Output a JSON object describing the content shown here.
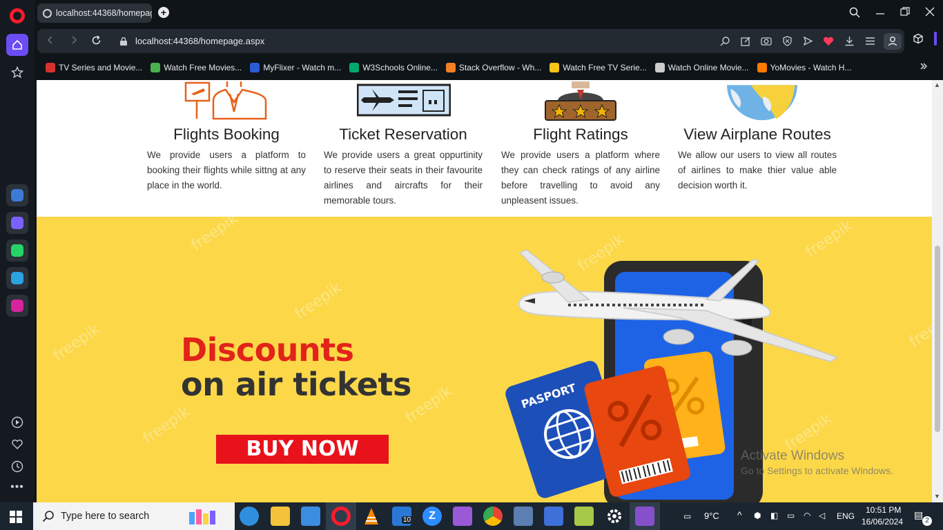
{
  "browser": {
    "tab_title": "localhost:44368/homepag",
    "url": "localhost:44368/homepage.aspx",
    "bookmarks": [
      {
        "label": "TV Series and Movie...",
        "color": "#d8312d"
      },
      {
        "label": "Watch Free Movies...",
        "color": "#4caf50"
      },
      {
        "label": "MyFlixer - Watch m...",
        "color": "#2b5cd6"
      },
      {
        "label": "W3Schools Online...",
        "color": "#04aa6d"
      },
      {
        "label": "Stack Overflow - Wh...",
        "color": "#f48024"
      },
      {
        "label": "Watch Free TV Serie...",
        "color": "#f5c518"
      },
      {
        "label": "Watch Online Movie...",
        "color": "#cccccc"
      },
      {
        "label": "YoMovies - Watch H...",
        "color": "#ff7a00"
      }
    ],
    "sidebar_apps": [
      {
        "name": "aria-icon",
        "color": "#3a7bd5"
      },
      {
        "name": "messenger-icon",
        "color": "#7b61ff"
      },
      {
        "name": "whatsapp-icon",
        "color": "#25d366"
      },
      {
        "name": "telegram-icon",
        "color": "#2aa3de"
      },
      {
        "name": "instagram-icon",
        "color": "#d6249f"
      }
    ]
  },
  "features": [
    {
      "title": "Flights Booking",
      "description": "We provide users a platform to booking their flights while sittng at any place in the world."
    },
    {
      "title": "Ticket Reservation",
      "description": "We provide users a great oppurtinity to reserve their seats in their favourite airlines and aircrafts for their memorable tours."
    },
    {
      "title": "Flight Ratings",
      "description": "We provide users a platform where they can check ratings of any airline before travelling to avoid any unpleasent issues."
    },
    {
      "title": "View Airplane Routes",
      "description": "We allow our users to view all routes of airlines to make thier value able decision worth it."
    }
  ],
  "banner": {
    "headline_line1": "Discounts",
    "headline_line2": "on air tickets",
    "cta_label": "BUY NOW",
    "passport_label": "PASPORT",
    "watermark": "freepik"
  },
  "activation": {
    "title": "Activate Windows",
    "subtitle": "Go to Settings to activate Windows."
  },
  "taskbar": {
    "search_placeholder": "Type here to search",
    "weather": "9°C",
    "language": "ENG",
    "time": "10:51 PM",
    "date": "16/06/2024",
    "mail_badge": "10",
    "notification_count": "2"
  }
}
